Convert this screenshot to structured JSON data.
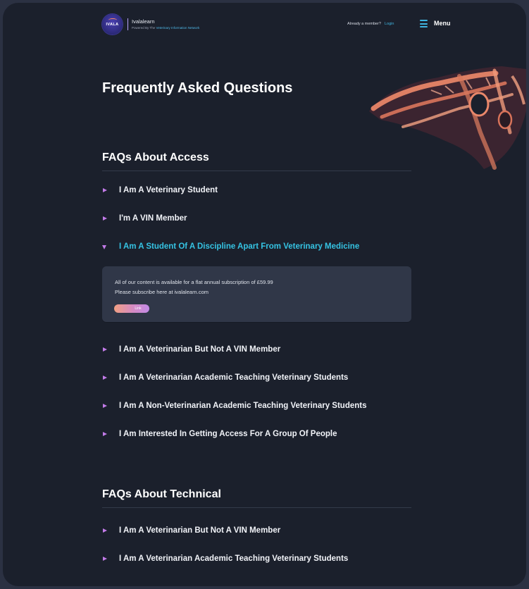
{
  "header": {
    "logo_text": "IVALA",
    "brand_name": "Ivalalearn",
    "powered_by_prefix": "Powered By The",
    "powered_by_network": "Veterinary Information Network",
    "member_prompt": "Already a member?",
    "login_label": "Login",
    "menu_label": "Menu",
    "menu_icon": "hamburger-icon"
  },
  "page": {
    "title": "Frequently Asked Questions"
  },
  "sections": [
    {
      "title": "FAQs About Access",
      "items": [
        {
          "label": "I Am A Veterinary Student",
          "expanded": false
        },
        {
          "label": "I'm A VIN Member",
          "expanded": false
        },
        {
          "label": "I Am A Student Of A Discipline Apart From Veterinary Medicine",
          "expanded": true
        },
        {
          "label": "I Am A Veterinarian But Not A VIN Member",
          "expanded": false
        },
        {
          "label": "I Am A Veterinarian Academic Teaching Veterinary Students",
          "expanded": false
        },
        {
          "label": "I Am A Non-Veterinarian Academic Teaching Veterinary Students",
          "expanded": false
        },
        {
          "label": "I Am Interested In Getting Access For A Group Of People",
          "expanded": false
        }
      ],
      "answer": {
        "line1": "All of our content is available for a flat annual subscription of £59.99",
        "line2": "Please subscribe here at ivalalearn.com",
        "button_label": "Link"
      }
    },
    {
      "title": "FAQs About Technical",
      "items": [
        {
          "label": "I Am A Veterinarian But Not A VIN Member",
          "expanded": false
        },
        {
          "label": "I Am A Veterinarian Academic Teaching Veterinary Students",
          "expanded": false
        }
      ]
    }
  ],
  "colors": {
    "background": "#1b202c",
    "accent_cyan": "#35c3e3",
    "arrow_purple": "#c27be8",
    "panel": "#303748",
    "button_gradient_start": "#f2a083",
    "button_gradient_end": "#c28ae6"
  },
  "icons": {
    "collapsed_item": "caret-right-icon",
    "expanded_item": "caret-down-icon",
    "hero": "anatomy-skull-illustration"
  }
}
